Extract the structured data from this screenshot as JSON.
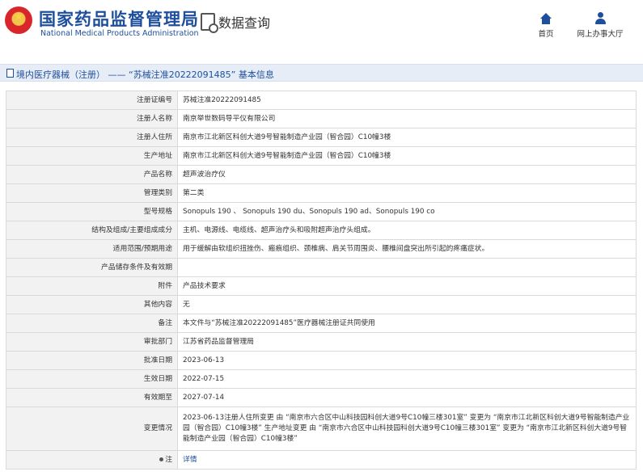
{
  "header": {
    "site_title": "国家药品监督管理局",
    "site_subtitle": "National Medical Products Administration",
    "query_label": "数据查询",
    "nav": [
      {
        "label": "首页",
        "icon": "home-icon"
      },
      {
        "label": "网上办事大厅",
        "icon": "user-icon"
      }
    ]
  },
  "page_title": "境内医疗器械（注册） —— “苏械注准20222091485” 基本信息",
  "rows": [
    {
      "label": "注册证编号",
      "value": "苏械注准20222091485"
    },
    {
      "label": "注册人名称",
      "value": "南京举世数码导平仪有限公司"
    },
    {
      "label": "注册人住所",
      "value": "南京市江北新区科创大道9号智能制造产业园（智合园）C10幢3楼"
    },
    {
      "label": "生产地址",
      "value": "南京市江北新区科创大道9号智能制造产业园（智合园）C10幢3楼"
    },
    {
      "label": "产品名称",
      "value": "超声波治疗仪"
    },
    {
      "label": "管理类别",
      "value": "第二类"
    },
    {
      "label": "型号规格",
      "value": "Sonopuls 190 、 Sonopuls 190 du、Sonopuls 190 ad、Sonopuls 190 co"
    },
    {
      "label": "结构及组成/主要组成成分",
      "value": "主机、电源线、电缆线、超声治疗头和吸附超声治疗头组成。"
    },
    {
      "label": "适用范围/预期用途",
      "value": "用于缓解由软组织扭挫伤、瘢痕组织、颈椎病、肩关节周围炎、腰椎间盘突出所引起的疼痛症状。"
    },
    {
      "label": "产品储存条件及有效期",
      "value": ""
    },
    {
      "label": "附件",
      "value": "产品技术要求"
    },
    {
      "label": "其他内容",
      "value": "无"
    },
    {
      "label": "备注",
      "value": "本文件与“苏械注准20222091485”医疗器械注册证共同使用"
    },
    {
      "label": "审批部门",
      "value": "江苏省药品监督管理局"
    },
    {
      "label": "批准日期",
      "value": "2023-06-13"
    },
    {
      "label": "生效日期",
      "value": "2022-07-15"
    },
    {
      "label": "有效期至",
      "value": "2027-07-14"
    },
    {
      "label": "变更情况",
      "value": "2023-06-13注册人住所变更 由 “南京市六合区中山科技园科创大道9号C10幢三楼301室” 变更为 “南京市江北新区科创大道9号智能制造产业园（智合园）C10幢3楼” 生产地址变更 由 “南京市六合区中山科技园科创大道9号C10幢三楼301室” 变更为 “南京市江北新区科创大道9号智能制造产业园（智合园）C10幢3楼”"
    },
    {
      "label": "注",
      "value": "详情"
    }
  ],
  "colors": {
    "brand_blue": "#1d4f9c",
    "label_bg": "#f2f2f2",
    "titlebar_bg": "#e6edf6"
  }
}
